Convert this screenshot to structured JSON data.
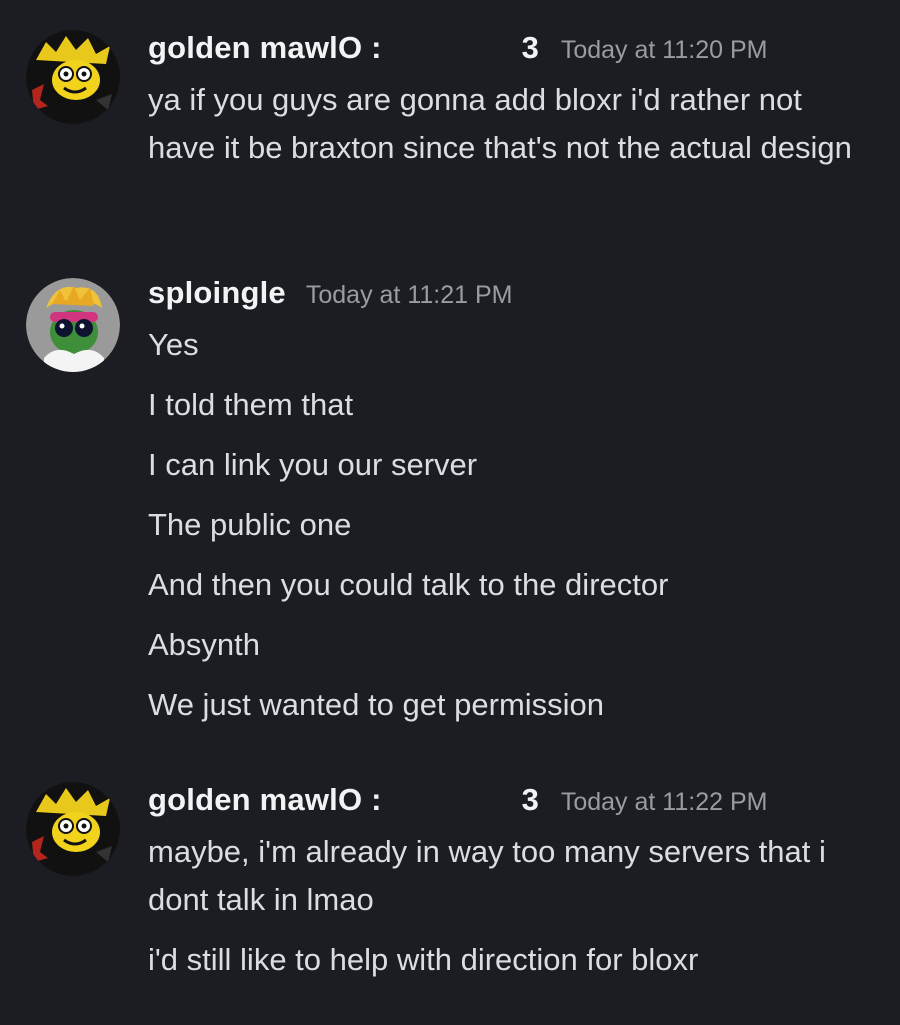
{
  "messages": [
    {
      "author": "golden mawlO :",
      "badge": "3",
      "timestamp": "Today at 11:20 PM",
      "lines": [
        "ya if you guys are gonna add bloxr i'd rather not have it be braxton since that's not the actual design"
      ]
    },
    {
      "author": "sploingle",
      "timestamp": "Today at 11:21 PM",
      "lines": [
        "Yes",
        "I told them that",
        "I can link you our server",
        "The public one",
        "And then you could talk to the director",
        "Absynth",
        "We just wanted to get permission"
      ]
    },
    {
      "author": "golden mawlO :",
      "badge": "3",
      "timestamp": "Today at 11:22 PM",
      "lines": [
        "maybe, i'm already in way too many servers that i dont talk in lmao",
        "i'd still like to help with direction for bloxr"
      ]
    }
  ],
  "colors": {
    "background": "#1c1d22",
    "username": "#f2f3f5",
    "text": "#dcdde1",
    "timestamp": "#9a9ca3"
  }
}
